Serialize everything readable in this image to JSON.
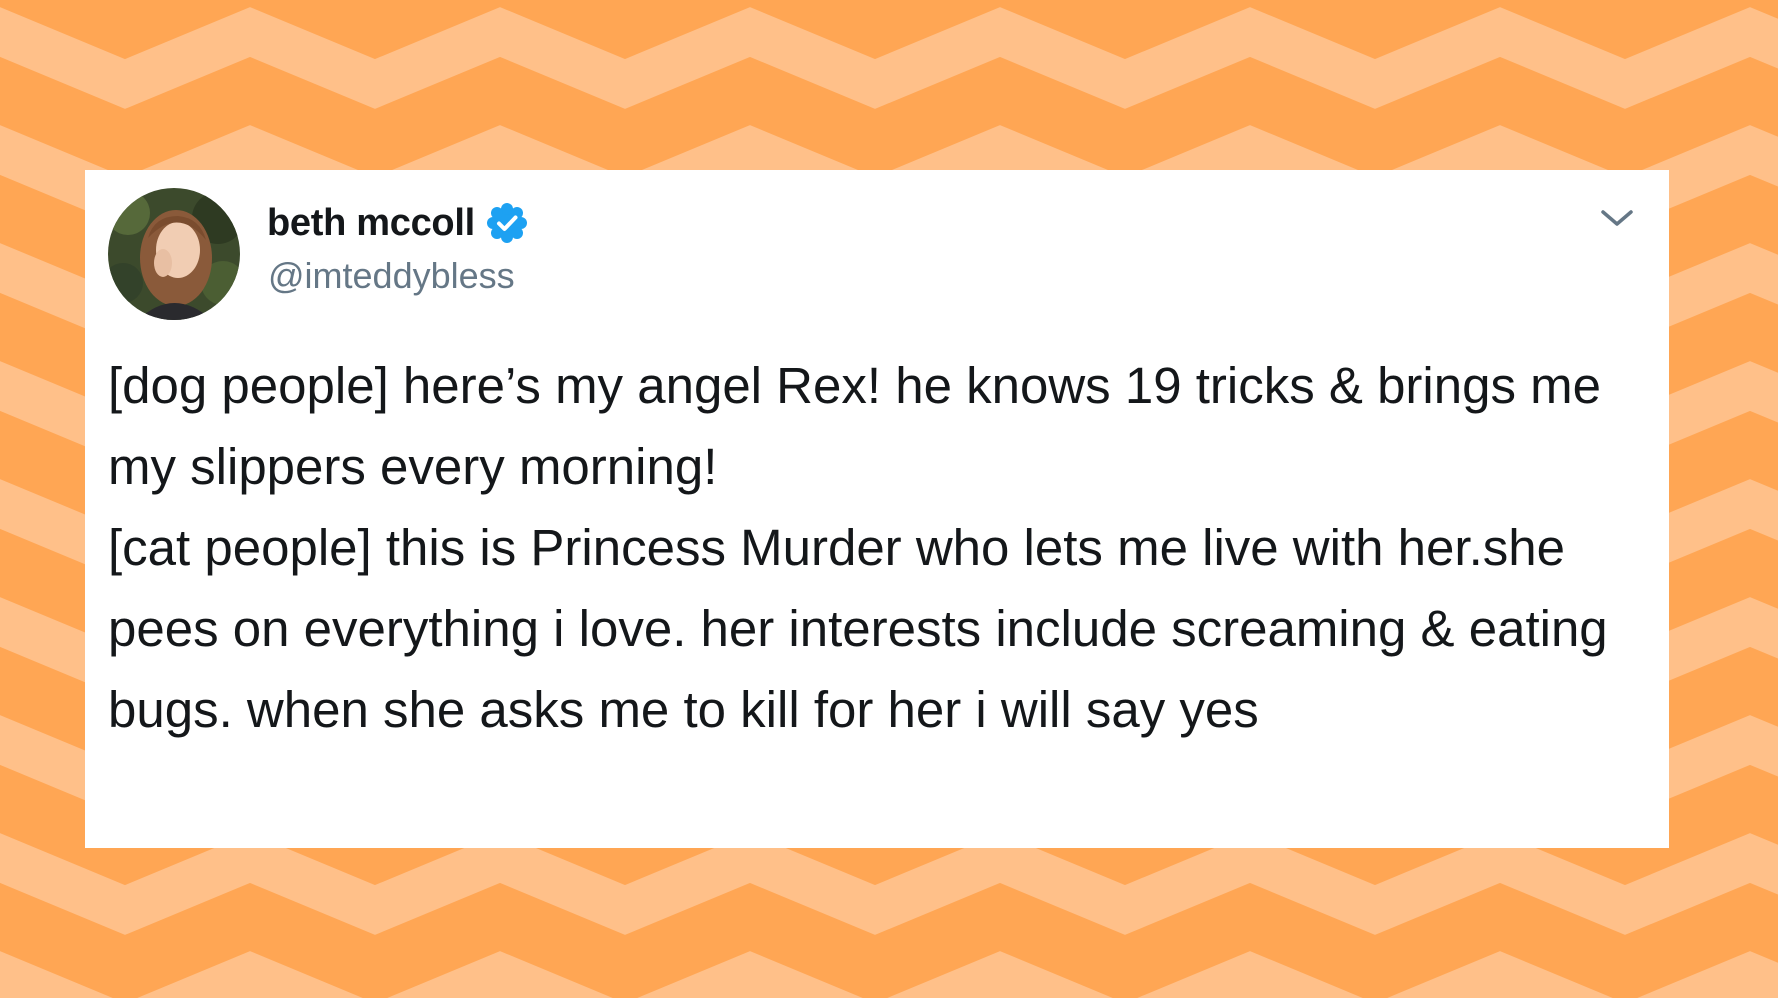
{
  "colors": {
    "background_orange": "#ffa654",
    "zigzag_light": "#ffc089",
    "card_background": "#ffffff",
    "verified_blue": "#1da1f2",
    "text_primary": "#14171a",
    "text_secondary": "#657786"
  },
  "tweet": {
    "author": {
      "display_name": "beth mccoll",
      "handle": "@imteddybless",
      "verified": true,
      "avatar_icon": "user-avatar-photo"
    },
    "menu_icon": "chevron-down-icon",
    "text": "[dog people] here’s my angel Rex! he knows 19 tricks & brings me my slippers every morning!\n[cat people] this is Princess Murder who lets me live with her.she pees on everything i love. her interests include screaming & eating bugs. when she asks me to kill for her i will say yes"
  }
}
